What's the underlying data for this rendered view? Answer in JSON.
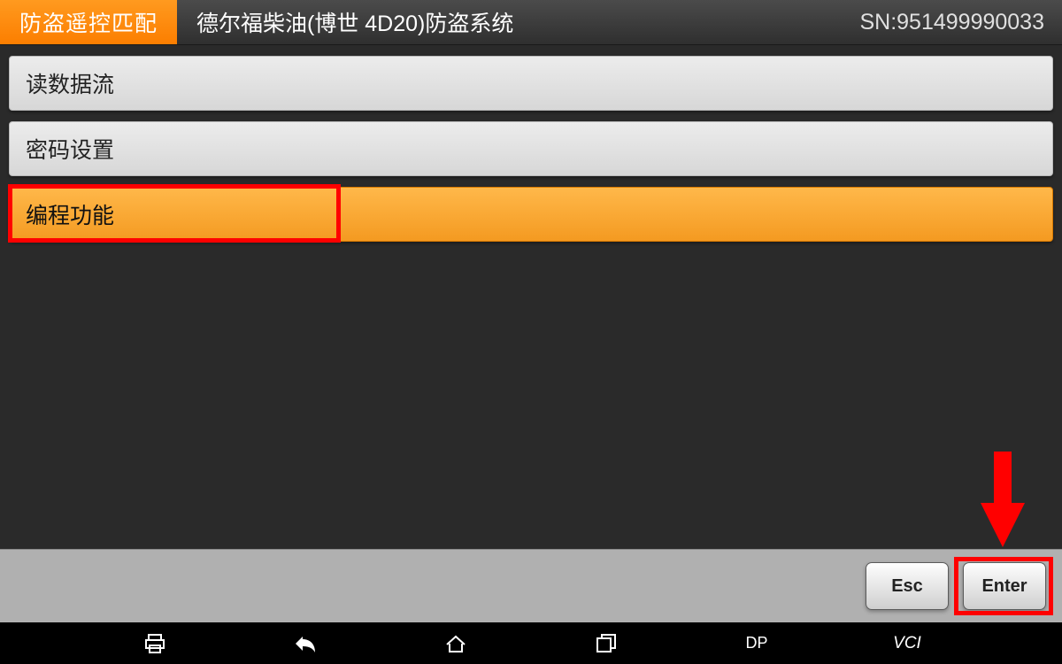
{
  "header": {
    "context": "防盗遥控匹配",
    "title": "德尔福柴油(博世 4D20)防盗系统",
    "sn_label": "SN:951499990033"
  },
  "menu": {
    "items": [
      {
        "label": "读数据流",
        "selected": false
      },
      {
        "label": "密码设置",
        "selected": false
      },
      {
        "label": "编程功能",
        "selected": true
      }
    ]
  },
  "footer": {
    "esc_label": "Esc",
    "enter_label": "Enter"
  },
  "navbar": {
    "dp_label": "DP",
    "vci_label": "VCI"
  },
  "colors": {
    "accent": "#f49a21",
    "annotation": "#ff0000"
  }
}
